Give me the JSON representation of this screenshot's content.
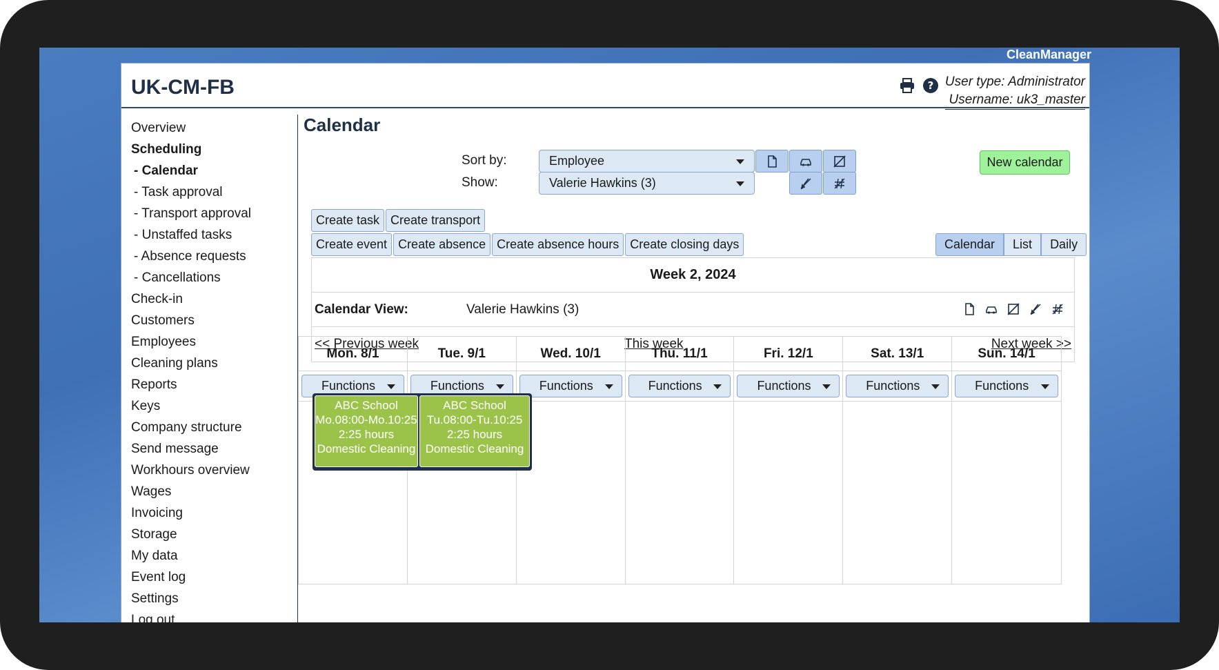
{
  "brand": "CleanManager",
  "site_title": "UK-CM-FB",
  "user": {
    "type_line": "User type: Administrator",
    "username_line": "Username: uk3_master"
  },
  "icons": {
    "print": "printer-icon",
    "help": "help-icon",
    "task": "document-icon",
    "transport": "car-icon",
    "absence": "no-entry-icon",
    "unstaffed": "crossed-broom-icon",
    "cancelled": "crossed-hash-icon"
  },
  "sidebar": {
    "items": [
      {
        "label": "Overview"
      },
      {
        "label": "Scheduling"
      },
      {
        "label": "- Calendar"
      },
      {
        "label": "- Task approval"
      },
      {
        "label": "- Transport approval"
      },
      {
        "label": "- Unstaffed tasks"
      },
      {
        "label": "- Absence requests"
      },
      {
        "label": "- Cancellations"
      },
      {
        "label": "Check-in"
      },
      {
        "label": "Customers"
      },
      {
        "label": "Employees"
      },
      {
        "label": "Cleaning plans"
      },
      {
        "label": "Reports"
      },
      {
        "label": "Keys"
      },
      {
        "label": "Company structure"
      },
      {
        "label": "Send message"
      },
      {
        "label": "Workhours overview"
      },
      {
        "label": "Wages"
      },
      {
        "label": "Invoicing"
      },
      {
        "label": "Storage"
      },
      {
        "label": "My data"
      },
      {
        "label": "Event log"
      },
      {
        "label": "Settings"
      },
      {
        "label": "Log out"
      }
    ]
  },
  "page_title": "Calendar",
  "filters": {
    "sort_label": "Sort by:",
    "sort_value": "Employee",
    "show_label": "Show:",
    "show_value": "Valerie Hawkins (3)"
  },
  "new_calendar_label": "New calendar",
  "create_buttons_row1": [
    "Create task",
    "Create transport"
  ],
  "create_buttons_row2": [
    "Create event",
    "Create absence",
    "Create absence hours",
    "Create closing days"
  ],
  "view_toggle": [
    "Calendar",
    "List",
    "Daily"
  ],
  "week_title": "Week 2, 2024",
  "calendar_view_label": "Calendar View:",
  "calendar_view_value": "Valerie Hawkins (3)",
  "week_nav": {
    "prev": "<< Previous week",
    "this": "This week",
    "next": "Next week >>"
  },
  "days": [
    {
      "label": "Mon. 8/1",
      "func": "Functions"
    },
    {
      "label": "Tue. 9/1",
      "func": "Functions"
    },
    {
      "label": "Wed. 10/1",
      "func": "Functions"
    },
    {
      "label": "Thu. 11/1",
      "func": "Functions"
    },
    {
      "label": "Fri. 12/1",
      "func": "Functions"
    },
    {
      "label": "Sat. 13/1",
      "func": "Functions"
    },
    {
      "label": "Sun. 14/1",
      "func": "Functions"
    }
  ],
  "events": [
    {
      "customer": "ABC School",
      "time": "Mo.08:00-Mo.10:25",
      "hours": "2:25 hours",
      "type": "Domestic Cleaning"
    },
    {
      "customer": "ABC School",
      "time": "Tu.08:00-Tu.10:25",
      "hours": "2:25 hours",
      "type": "Domestic Cleaning"
    }
  ],
  "colors": {
    "event_bg": "#9bc34a",
    "new_calendar_bg": "#9df29a",
    "primary_button": "#b9cff0",
    "heading": "#1f2f46"
  }
}
